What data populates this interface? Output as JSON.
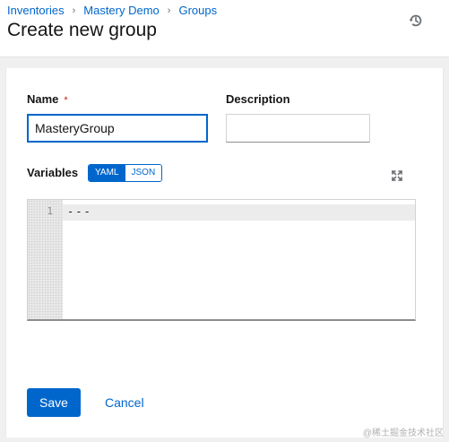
{
  "breadcrumb": {
    "items": [
      "Inventories",
      "Mastery Demo",
      "Groups"
    ],
    "separator": "›"
  },
  "page_title": "Create new group",
  "form": {
    "name_label": "Name",
    "name_required_marker": "*",
    "name_value": "MasteryGroup",
    "description_label": "Description",
    "description_value": "",
    "variables_label": "Variables",
    "toggle_options": [
      "YAML",
      "JSON"
    ],
    "toggle_selected": "YAML"
  },
  "editor": {
    "line_numbers": [
      "1"
    ],
    "lines": [
      "---"
    ]
  },
  "actions": {
    "save_label": "Save",
    "cancel_label": "Cancel"
  },
  "watermark": "@稀土掘金技术社区",
  "icons": {
    "history": "history-icon",
    "expand": "expand-icon"
  },
  "colors": {
    "accent": "#0066cc",
    "required": "#c9190b",
    "page_bg": "#f0f0f0"
  }
}
